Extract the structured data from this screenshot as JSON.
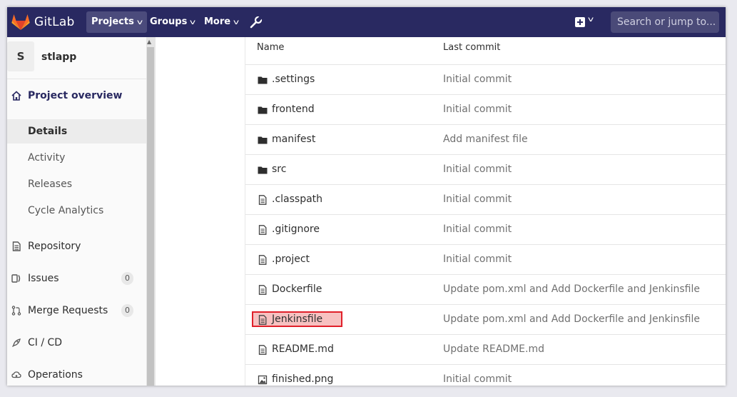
{
  "nav": {
    "brand": "GitLab",
    "projects_label": "Projects",
    "groups_label": "Groups",
    "more_label": "More",
    "search_placeholder": "Search or jump to...",
    "wrench_icon": "wrench-icon",
    "plus_icon": "plus-square-icon",
    "accent": "#292961"
  },
  "project": {
    "avatar_letter": "S",
    "name": "stlapp"
  },
  "sidebar": {
    "overview": "Project overview",
    "sub_items": [
      "Details",
      "Activity",
      "Releases",
      "Cycle Analytics"
    ],
    "active_sub": "Details",
    "items": [
      {
        "label": "Repository",
        "icon": "book-icon"
      },
      {
        "label": "Issues",
        "icon": "issues-icon",
        "badge": "0"
      },
      {
        "label": "Merge Requests",
        "icon": "merge-request-icon",
        "badge": "0"
      },
      {
        "label": "CI / CD",
        "icon": "rocket-icon"
      },
      {
        "label": "Operations",
        "icon": "cloud-gear-icon"
      }
    ]
  },
  "table": {
    "col_name": "Name",
    "col_commit": "Last commit",
    "rows": [
      {
        "name": ".settings",
        "type": "folder",
        "commit": "Initial commit"
      },
      {
        "name": "frontend",
        "type": "folder",
        "commit": "Initial commit"
      },
      {
        "name": "manifest",
        "type": "folder",
        "commit": "Add manifest file"
      },
      {
        "name": "src",
        "type": "folder",
        "commit": "Initial commit"
      },
      {
        "name": ".classpath",
        "type": "file",
        "commit": "Initial commit"
      },
      {
        "name": ".gitignore",
        "type": "file",
        "commit": "Initial commit"
      },
      {
        "name": ".project",
        "type": "file",
        "commit": "Initial commit"
      },
      {
        "name": "Dockerfile",
        "type": "file",
        "commit": "Update pom.xml and Add Dockerfile and Jenkinsfile"
      },
      {
        "name": "Jenkinsfile",
        "type": "file",
        "commit": "Update pom.xml and Add Dockerfile and Jenkinsfile",
        "highlighted": true
      },
      {
        "name": "README.md",
        "type": "file",
        "commit": "Update README.md"
      },
      {
        "name": "finished.png",
        "type": "image",
        "commit": "Initial commit"
      }
    ]
  }
}
